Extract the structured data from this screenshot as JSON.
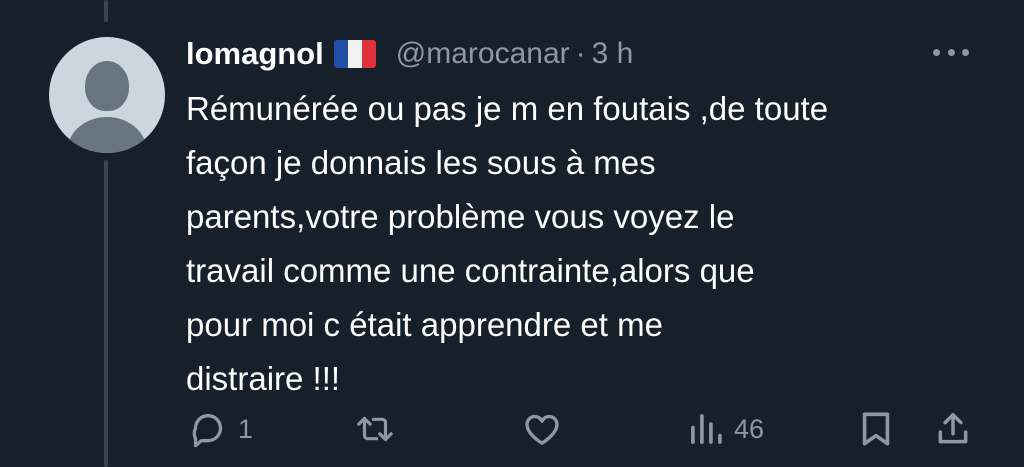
{
  "author": {
    "display_name": "lomagnol",
    "flag_emoji": "🇫🇷",
    "handle": "@marocanar",
    "separator": "·",
    "time_ago": "3 h"
  },
  "tweet": {
    "lines": [
      "Rémunérée ou pas je m en foutais ,de toute",
      "façon je donnais les sous à mes",
      "parents,votre problème vous voyez le",
      "travail comme une contrainte,alors que",
      "pour moi c était apprendre et me",
      "distraire !!!"
    ]
  },
  "actions": {
    "reply_count": "1",
    "retweet_count": "",
    "like_count": "",
    "views_count": "46"
  },
  "icons": {
    "more": "more-icon",
    "reply": "reply-icon",
    "retweet": "retweet-icon",
    "like": "heart-icon",
    "views": "analytics-icon",
    "bookmark": "bookmark-icon",
    "share": "share-icon"
  },
  "colors": {
    "background": "#15202b",
    "text": "#ffffff",
    "secondary_text": "#8b98a5",
    "thread_line": "#38444d",
    "avatar_bg": "#ccd6dd",
    "avatar_fg": "#66757f"
  }
}
